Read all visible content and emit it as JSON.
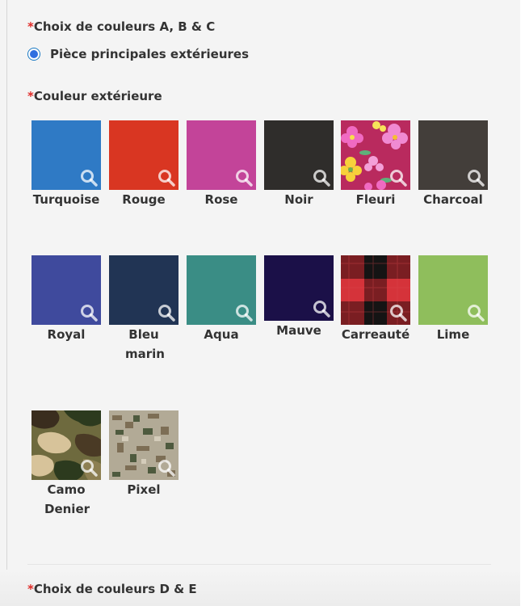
{
  "sections": {
    "abc": {
      "required": "*",
      "label": "Choix de couleurs A, B & C"
    },
    "radio": {
      "label": "Pièce principales extérieures",
      "checked": true
    },
    "exterior": {
      "required": "*",
      "label": "Couleur extérieure"
    },
    "de": {
      "required": "*",
      "label": "Choix de couleurs D & E"
    }
  },
  "swatches": [
    {
      "name": "Turquoise",
      "color": "#2f7ac5"
    },
    {
      "name": "Rouge",
      "color": "#d93622"
    },
    {
      "name": "Rose",
      "color": "#c34499"
    },
    {
      "name": "Noir",
      "color": "#2f2d2b"
    },
    {
      "name": "Fleuri",
      "color": "#b92a5e",
      "icon": "floral-pattern"
    },
    {
      "name": "Charcoal",
      "color": "#433e3a"
    },
    {
      "name": "Royal",
      "color": "#3f4a9d"
    },
    {
      "name": "Bleu marin",
      "color": "#213454"
    },
    {
      "name": "Aqua",
      "color": "#3a8d85"
    },
    {
      "name": "Mauve",
      "color": "#1b1048"
    },
    {
      "name": "Carreauté",
      "color": "#a1232b",
      "icon": "plaid-pattern"
    },
    {
      "name": "Lime",
      "color": "#8fbe5c"
    },
    {
      "name": "Camo Denier",
      "color": "#6e6a3e",
      "icon": "camo-pattern"
    },
    {
      "name": "Pixel",
      "color": "#8e8676",
      "icon": "pixel-camo-pattern"
    }
  ]
}
